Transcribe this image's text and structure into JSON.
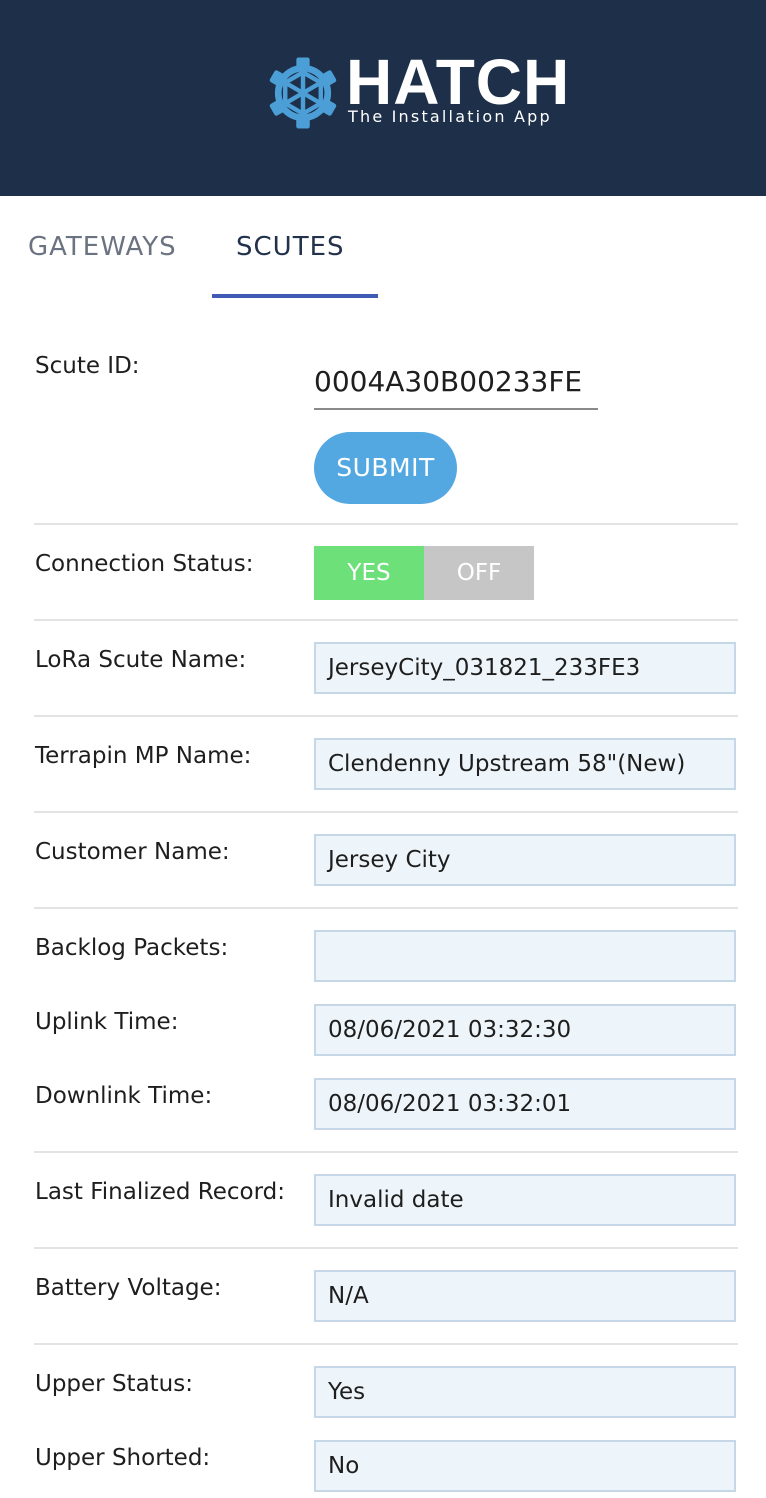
{
  "header": {
    "logo_icon": "gear-icon",
    "title": "HATCH",
    "subtitle": "The Installation App",
    "background_color": "#1d2f49",
    "logo_color": "#4c9fd6"
  },
  "tabs": [
    {
      "label": "GATEWAYS",
      "active": false
    },
    {
      "label": "SCUTES",
      "active": true
    }
  ],
  "scute_id": {
    "label": "Scute ID:",
    "value": "0004A30B00233FE"
  },
  "submit_label": "SUBMIT",
  "connection": {
    "label": "Connection Status:",
    "yes_label": "YES",
    "off_label": "OFF",
    "selected": "YES"
  },
  "fields": {
    "lora_name": {
      "label": "LoRa Scute Name:",
      "value": "JerseyCity_031821_233FE3"
    },
    "terrapin_name": {
      "label": "Terrapin MP Name:",
      "value": "Clendenny Upstream 58\"(New)"
    },
    "customer_name": {
      "label": "Customer Name:",
      "value": "Jersey City"
    },
    "backlog_packets": {
      "label": "Backlog Packets:",
      "value": ""
    },
    "uplink_time": {
      "label": "Uplink Time:",
      "value": "08/06/2021 03:32:30"
    },
    "downlink_time": {
      "label": "Downlink Time:",
      "value": "08/06/2021 03:32:01"
    },
    "last_finalized": {
      "label": "Last Finalized Record:",
      "value": "Invalid date"
    },
    "battery_voltage": {
      "label": "Battery Voltage:",
      "value": "N/A"
    },
    "upper_status": {
      "label": "Upper Status:",
      "value": "Yes"
    },
    "upper_shorted": {
      "label": "Upper Shorted:",
      "value": "No"
    }
  },
  "colors": {
    "accent": "#54a8e1",
    "tab_indicator": "#3f5ab5",
    "toggle_on": "#6ee07a",
    "toggle_off": "#c6c6c6",
    "field_bg": "#eef5fa"
  }
}
